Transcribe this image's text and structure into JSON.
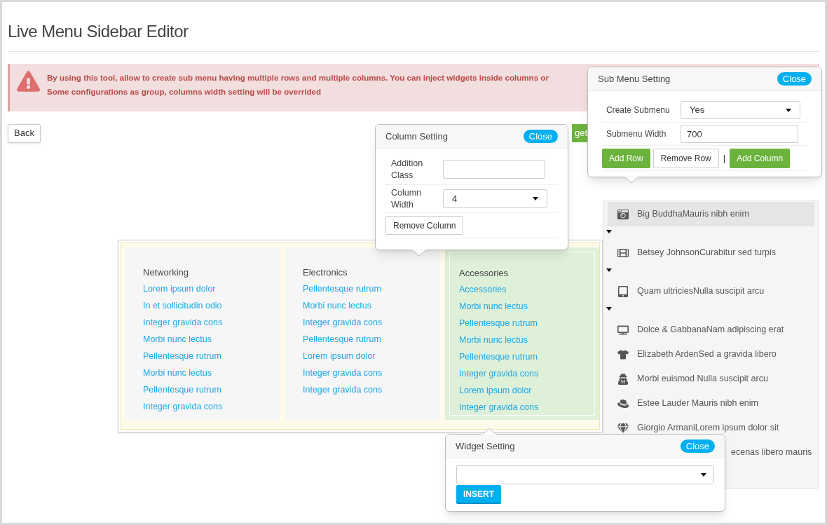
{
  "page": {
    "title": "Live Menu Sidebar Editor"
  },
  "alert": {
    "lines": [
      "By using this tool, allow to create sub menu having multiple rows and multiple columns. You can inject widgets inside columns or",
      "Some configurations as group, columns width setting will be overrided"
    ]
  },
  "toolbar": {
    "back": "Back",
    "add_widget": "get"
  },
  "submenu_preview": {
    "columns": [
      {
        "heading": "Networking",
        "selected": false,
        "links": [
          "Lorem ipsum dolor",
          "In et sollicitudin odio",
          "Integer gravida cons",
          "Morbi nunc lectus",
          "Pellentesque rutrum",
          "Morbi nunc lectus",
          "Pellentesque rutrum",
          "Integer gravida cons"
        ]
      },
      {
        "heading": "Electronics",
        "selected": false,
        "links": [
          "Pellentesque rutrum",
          "Morbi nunc lectus",
          "Integer gravida cons",
          "Pellentesque rutrum",
          "Lorem ipsum dolor",
          "Integer gravida cons",
          "Integer gravida cons"
        ]
      },
      {
        "heading": "Accessories",
        "selected": true,
        "links": [
          "Accessories",
          "Morbi nunc lectus",
          "Pellentesque rutrum",
          "Morbi nunc lectus",
          "Pellentesque rutrum",
          "Integer gravida cons",
          "Lorem ipsum dolor",
          "Integer gravida cons"
        ]
      }
    ]
  },
  "sidebar": {
    "items": [
      {
        "label": "Big BuddhaMauris nibh enim",
        "selected": true,
        "has_submenu": true
      },
      {
        "label": "Betsey JohnsonCurabitur sed turpis",
        "selected": false,
        "has_submenu": true
      },
      {
        "label": "Quam ultriciesNulla suscipit arcu",
        "selected": false,
        "has_submenu": true
      },
      {
        "label": "Dolce & GabbanaNam adipiscing erat",
        "selected": false,
        "has_submenu": false
      },
      {
        "label": "Elizabeth ArdenSed a gravida libero",
        "selected": false,
        "has_submenu": false
      },
      {
        "label": "Morbi euismod Nulla suscipit arcu",
        "selected": false,
        "has_submenu": false
      },
      {
        "label": "Estee Lauder Mauris nibh enim",
        "selected": false,
        "has_submenu": false
      },
      {
        "label": "Giorgio ArmaniLorem ipsum dolor sit",
        "selected": false,
        "has_submenu": false
      },
      {
        "label": "ecenas libero mauris",
        "selected": false,
        "has_submenu": false,
        "kind": "covered"
      }
    ]
  },
  "submenu_setting": {
    "title": "Sub Menu Setting",
    "close": "Close",
    "create_label": "Create Submenu",
    "create_value": "Yes",
    "width_label": "Submenu Width",
    "width_value": "700",
    "buttons": [
      {
        "label": "Add Row",
        "kind": "primary"
      },
      {
        "label": "Remove Row",
        "kind": "default"
      },
      {
        "label": "|",
        "kind": "separator"
      },
      {
        "label": "Add Column",
        "kind": "primary"
      }
    ]
  },
  "column_setting": {
    "title": "Column Setting",
    "close": "Close",
    "class_label": "Addition Class",
    "width_label": "Column Width",
    "width_value": "4",
    "remove": "Remove Column"
  },
  "widget_setting": {
    "title": "Widget Setting",
    "close": "Close",
    "insert": "INSERT"
  }
}
